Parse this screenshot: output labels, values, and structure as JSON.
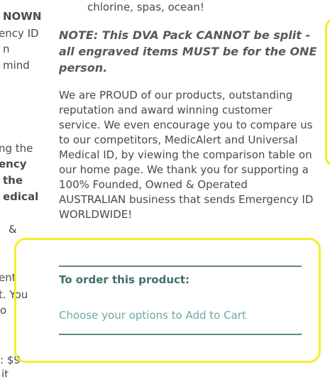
{
  "left_fragments": [
    {
      "text": "NOWN",
      "bold": true
    },
    {
      "text": "ency ID",
      "bold": false
    },
    {
      "text": "n",
      "bold": false
    },
    {
      "text": "mind",
      "bold": false
    },
    {
      "text": "ng the",
      "bold": false
    },
    {
      "text": "ency",
      "bold": true
    },
    {
      "text": "the",
      "bold": true
    },
    {
      "text": "edical",
      "bold": true
    },
    {
      "text": "&",
      "bold": false
    },
    {
      "text": "ent",
      "bold": false
    },
    {
      "text": "t. You",
      "bold": false
    },
    {
      "text": "o",
      "bold": false
    },
    {
      "text": ": $9",
      "bold": false
    },
    {
      "text": "it",
      "bold": false
    }
  ],
  "main": {
    "top_line": "chlorine, spas, ocean!",
    "note": "NOTE: This DVA Pack CANNOT be split - all engraved items MUST be for the ONE person.",
    "body": "We are PROUD of our products, outstanding reputation and award winning customer service. We even encourage you to compare us to our competitors, MedicAlert and Universal Medical ID, by viewing the comparison table on our home page. We thank you for supporting a 100% Founded, Owned & Operated AUSTRALIAN business that sends Emergency ID WORLDWIDE!"
  },
  "order": {
    "heading": "To order this product:",
    "cta": "Choose your options to Add to Cart"
  },
  "colors": {
    "highlight": "#f2ef2a",
    "divider": "#5c8a86",
    "heading": "#3f6f6d",
    "link": "#6aa9a5"
  }
}
